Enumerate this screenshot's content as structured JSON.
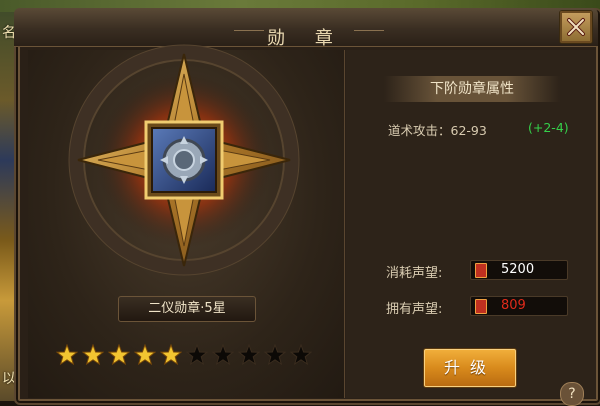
{
  "background": {
    "left_text_top": "名",
    "left_text_bottom": "以"
  },
  "window": {
    "title": "勋 章",
    "close_icon": "close-icon"
  },
  "medal": {
    "name": "二仪勋章·5星",
    "stars_total": 10,
    "stars_filled": 5,
    "star_filled_color": "#f2c531",
    "star_empty_color": "#0c0906"
  },
  "attributes": {
    "header": "下阶勋章属性",
    "line": "道术攻击：62-93",
    "bonus": "(+2-4)",
    "bonus_color": "#35d04a"
  },
  "resources": {
    "cost_label": "消耗声望:",
    "cost_value": "5200",
    "cost_color": "#ffffff",
    "owned_label": "拥有声望:",
    "owned_value": "809",
    "owned_color": "#e02a1a"
  },
  "actions": {
    "upgrade_label": "升级",
    "help_label": "?"
  }
}
